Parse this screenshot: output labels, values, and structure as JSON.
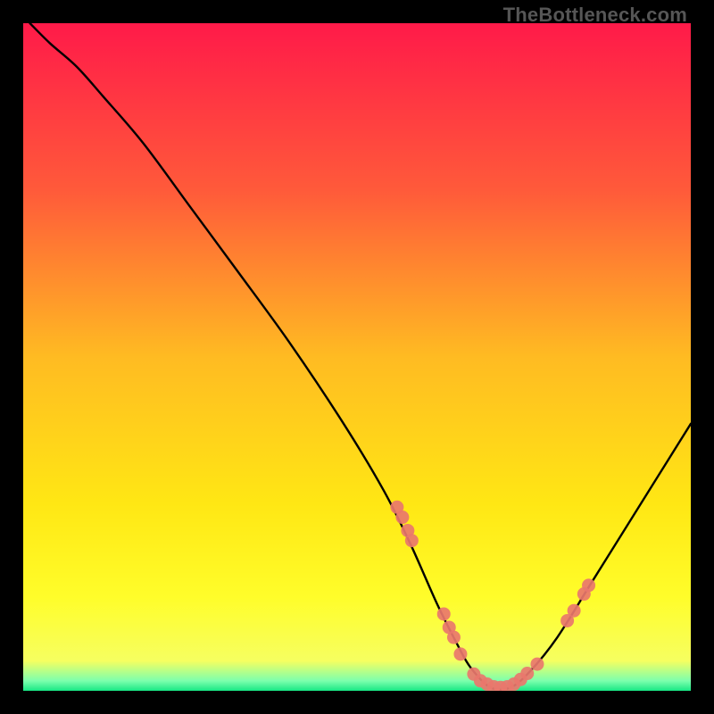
{
  "watermark": "TheBottleneck.com",
  "chart_data": {
    "type": "line",
    "title": "",
    "xlabel": "",
    "ylabel": "",
    "xlim": [
      0,
      100
    ],
    "ylim": [
      0,
      100
    ],
    "grid": false,
    "legend": false,
    "gradient_stops": [
      {
        "offset": 0.0,
        "color": "#ff1a49"
      },
      {
        "offset": 0.25,
        "color": "#ff5a3a"
      },
      {
        "offset": 0.5,
        "color": "#ffbb22"
      },
      {
        "offset": 0.72,
        "color": "#ffe714"
      },
      {
        "offset": 0.86,
        "color": "#fffd2a"
      },
      {
        "offset": 0.955,
        "color": "#f6ff60"
      },
      {
        "offset": 0.985,
        "color": "#7dffad"
      },
      {
        "offset": 1.0,
        "color": "#17e884"
      }
    ],
    "series": [
      {
        "name": "bottleneck-curve",
        "x": [
          1,
          4,
          8,
          12,
          18,
          25,
          32,
          40,
          48,
          54,
          58,
          62,
          65,
          67,
          70,
          73,
          76,
          80,
          85,
          90,
          95,
          100
        ],
        "y": [
          100,
          97,
          93.5,
          89,
          82,
          72.5,
          63,
          52,
          40,
          30,
          22,
          13,
          7,
          3.5,
          0.5,
          0.5,
          3,
          8,
          16,
          24,
          32,
          40
        ]
      }
    ],
    "markers": [
      {
        "x": 56.0,
        "y": 27.5
      },
      {
        "x": 56.8,
        "y": 26.0
      },
      {
        "x": 57.6,
        "y": 24.0
      },
      {
        "x": 58.2,
        "y": 22.5
      },
      {
        "x": 63.0,
        "y": 11.5
      },
      {
        "x": 63.8,
        "y": 9.5
      },
      {
        "x": 64.5,
        "y": 8.0
      },
      {
        "x": 65.5,
        "y": 5.5
      },
      {
        "x": 67.5,
        "y": 2.5
      },
      {
        "x": 68.5,
        "y": 1.5
      },
      {
        "x": 69.5,
        "y": 1.0
      },
      {
        "x": 70.5,
        "y": 0.6
      },
      {
        "x": 71.5,
        "y": 0.5
      },
      {
        "x": 72.5,
        "y": 0.6
      },
      {
        "x": 73.5,
        "y": 1.0
      },
      {
        "x": 74.5,
        "y": 1.7
      },
      {
        "x": 75.5,
        "y": 2.6
      },
      {
        "x": 77.0,
        "y": 4.0
      },
      {
        "x": 81.5,
        "y": 10.5
      },
      {
        "x": 82.5,
        "y": 12.0
      },
      {
        "x": 84.0,
        "y": 14.5
      },
      {
        "x": 84.7,
        "y": 15.8
      }
    ],
    "marker_style": {
      "radius": 7.5,
      "fill": "#e9776c",
      "alpha": 0.92
    }
  }
}
